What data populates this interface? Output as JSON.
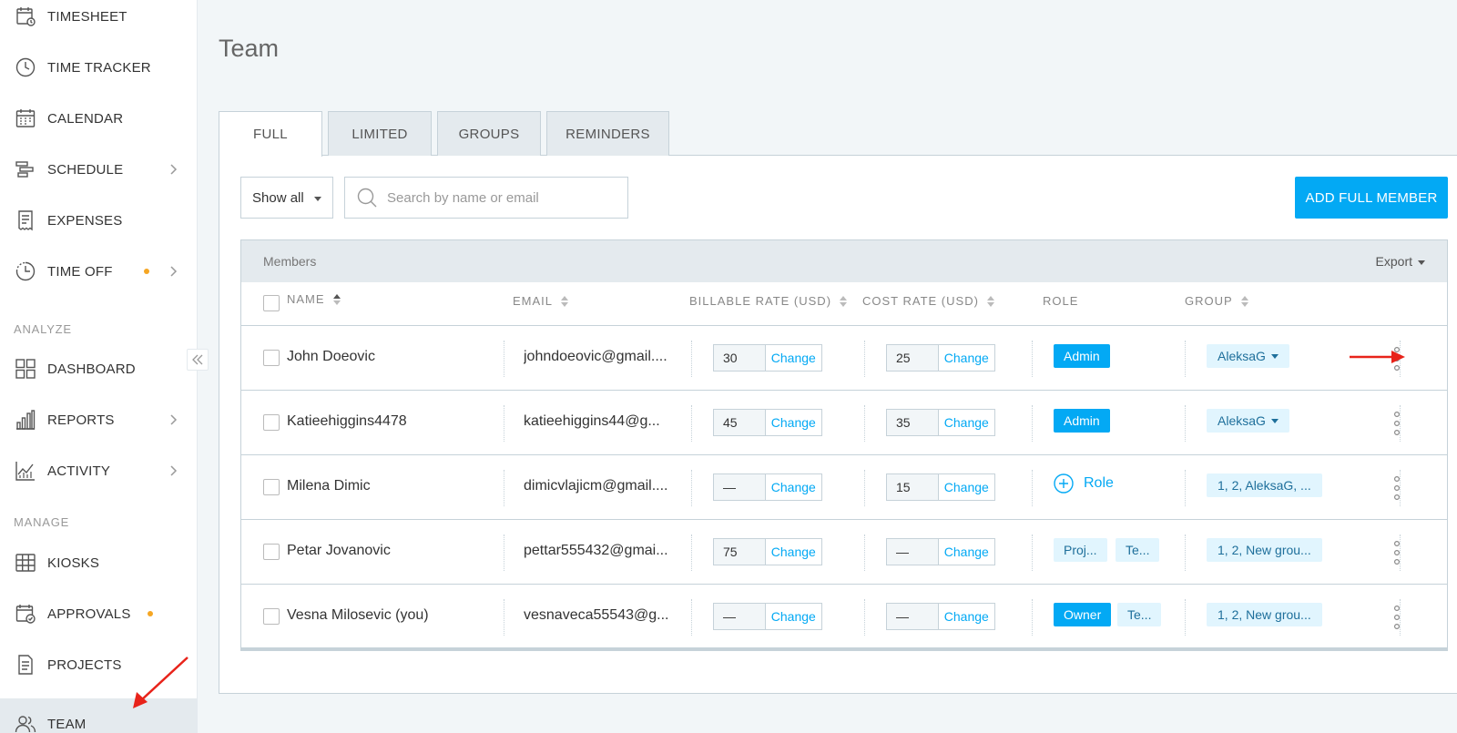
{
  "sidebar": {
    "items": [
      {
        "label": "TIMESHEET",
        "icon": "timesheet-icon"
      },
      {
        "label": "TIME TRACKER",
        "icon": "clock-icon"
      },
      {
        "label": "CALENDAR",
        "icon": "calendar-icon"
      },
      {
        "label": "SCHEDULE",
        "icon": "schedule-icon"
      },
      {
        "label": "EXPENSES",
        "icon": "receipt-icon"
      },
      {
        "label": "TIME OFF",
        "icon": "time-off-icon"
      },
      {
        "label": "DASHBOARD",
        "icon": "dashboard-icon"
      },
      {
        "label": "REPORTS",
        "icon": "bar-chart-icon"
      },
      {
        "label": "ACTIVITY",
        "icon": "activity-chart-icon"
      },
      {
        "label": "KIOSKS",
        "icon": "kiosk-icon"
      },
      {
        "label": "APPROVALS",
        "icon": "approvals-icon"
      },
      {
        "label": "PROJECTS",
        "icon": "document-icon"
      },
      {
        "label": "TEAM",
        "icon": "team-icon"
      }
    ],
    "sections": {
      "analyze": "ANALYZE",
      "manage": "MANAGE"
    },
    "active": "TEAM"
  },
  "page": {
    "title": "Team"
  },
  "tabs": [
    {
      "label": "FULL",
      "active": true
    },
    {
      "label": "LIMITED",
      "active": false
    },
    {
      "label": "GROUPS",
      "active": false
    },
    {
      "label": "REMINDERS",
      "active": false
    }
  ],
  "toolbar": {
    "filter_value": "Show all",
    "search_placeholder": "Search by name or email",
    "add_button": "ADD FULL MEMBER"
  },
  "table": {
    "section_label": "Members",
    "export_label": "Export",
    "columns": {
      "name": "NAME",
      "email": "EMAIL",
      "billable": "BILLABLE RATE (USD)",
      "cost": "COST RATE (USD)",
      "role": "ROLE",
      "group": "GROUP"
    },
    "change_label": "Change",
    "add_role_label": "Role",
    "rows": [
      {
        "name": "John Doeovic",
        "email": "johndoeovic@gmail....",
        "billable": "30",
        "cost": "25",
        "roles": [
          "Admin"
        ],
        "group": "AleksaG"
      },
      {
        "name": "Katieehiggins4478",
        "email": "katieehiggins44@g...",
        "billable": "45",
        "cost": "35",
        "roles": [
          "Admin"
        ],
        "group": "AleksaG"
      },
      {
        "name": "Milena Dimic",
        "email": "dimicvlajicm@gmail....",
        "billable": "—",
        "cost": "15",
        "roles": [],
        "group": "1, 2, AleksaG, ..."
      },
      {
        "name": "Petar Jovanovic",
        "email": "pettar555432@gmai...",
        "billable": "75",
        "cost": "—",
        "roles": [
          "Proj...",
          "Te..."
        ],
        "group": "1, 2, New grou..."
      },
      {
        "name": "Vesna Milosevic (you)",
        "email": "vesnaveca55543@g...",
        "billable": "—",
        "cost": "—",
        "roles": [
          "Owner",
          "Te..."
        ],
        "group": "1, 2, New grou..."
      }
    ]
  },
  "colors": {
    "accent": "#03a9f4",
    "annotation_arrow": "#e8231a",
    "dot": "#f5a623"
  }
}
